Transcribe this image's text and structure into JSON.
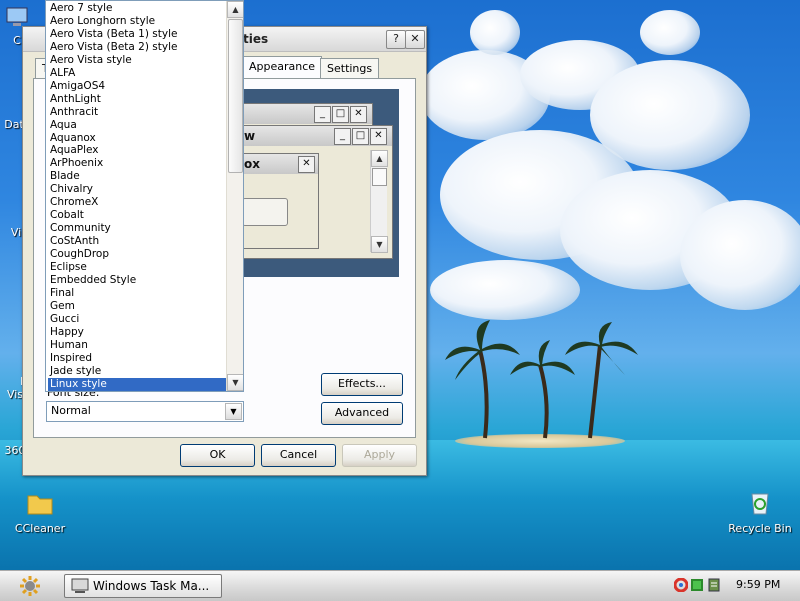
{
  "desktop": {
    "icons": [
      {
        "label": "C"
      },
      {
        "label": "Dat"
      },
      {
        "label": "M\nVi"
      },
      {
        "label": "M\nVis"
      },
      {
        "label": "360"
      },
      {
        "label": "CCleaner"
      },
      {
        "label": "Recycle Bin"
      }
    ]
  },
  "dialog": {
    "title_fragment": "ties",
    "help_button": "?",
    "close_button": "✕",
    "tabs": [
      {
        "label": "T"
      },
      {
        "label": "Appearance"
      },
      {
        "label": "Settings"
      }
    ],
    "preview": {
      "window2_title_fragment": "w",
      "window3_title_fragment": "ox"
    },
    "font_size_label": "Font size:",
    "font_size_value": "Normal",
    "effects_button": "Effects...",
    "advanced_button": "Advanced",
    "ok_button": "OK",
    "cancel_button": "Cancel",
    "apply_button": "Apply"
  },
  "style_list": {
    "items": [
      "Aero 7 style",
      "Aero Longhorn style",
      "Aero Vista (Beta 1) style",
      "Aero Vista (Beta 2) style",
      "Aero Vista style",
      "ALFA",
      "AmigaOS4",
      "AnthLight",
      "Anthracit",
      "Aqua",
      "Aquanox",
      "AquaPlex",
      "ArPhoenix",
      "Blade",
      "Chivalry",
      "ChromeX",
      "Cobalt",
      "Community",
      "CoStAnth",
      "CoughDrop",
      "Eclipse",
      "Embedded Style",
      "Final",
      "Gem",
      "Gucci",
      "Happy",
      "Human",
      "Inspired",
      "Jade style",
      "Linux style"
    ],
    "selected_index": 29
  },
  "taskbar": {
    "task_button_label": "Windows Task Ma...",
    "clock": "9:59 PM"
  }
}
